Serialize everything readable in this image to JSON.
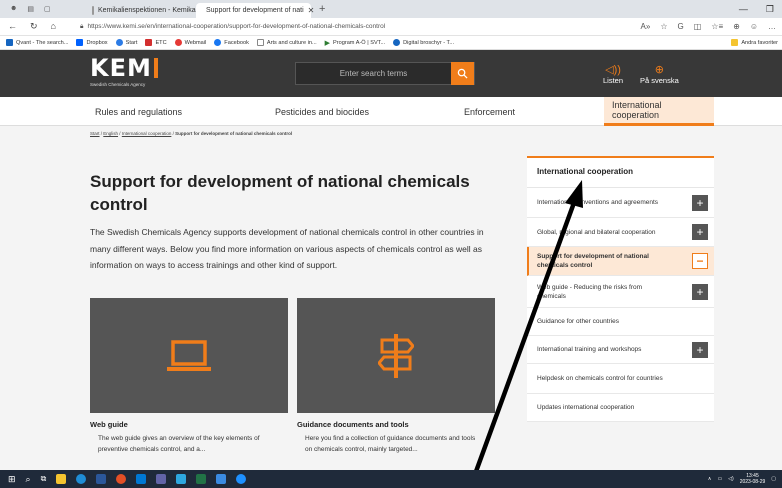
{
  "browser": {
    "tabs": [
      {
        "title": "Kemikalienspektionen - Kemikal"
      },
      {
        "title": "Support for development of nati"
      }
    ],
    "new_tab": "+",
    "url": "https://www.kemi.se/en/international-cooperation/support-for-development-of-national-chemicals-control",
    "bookmarks": [
      "Qvant - The search...",
      "Dropbox",
      "Start",
      "ETC",
      "Webmail",
      "Facebook",
      "Arts and culture in...",
      "Program A-Ö | SVT...",
      "Digital broschyr - T..."
    ],
    "bookmarks_other": "Andra favoriter"
  },
  "header": {
    "logo_text": "KEM",
    "logo_sub": "Swedish Chemicals Agency",
    "search_placeholder": "Enter search terms",
    "listen_label": "Listen",
    "swedish_label": "På svenska"
  },
  "nav": {
    "items": [
      "Rules and regulations",
      "Pesticides and biocides",
      "Enforcement",
      "International cooperation"
    ]
  },
  "breadcrumb": {
    "start": "Start",
    "english": "English",
    "intl": "International cooperation",
    "current": "Support for development of national chemicals control",
    "sep": " / "
  },
  "main": {
    "title": "Support for development of national chemicals control",
    "intro": "The Swedish Chemicals Agency supports development of national chemicals control in other countries in many different ways. Below you find more information on various aspects of chemicals control as well as information on ways to access trainings and other kind of support.",
    "cards": [
      {
        "title": "Web guide",
        "desc": "The web guide gives an overview of the key elements of preventive chemicals control, and a...",
        "icon": "laptop-icon"
      },
      {
        "title": "Guidance documents and tools",
        "desc": "Here you find a collection of guidance documents and tools on chemicals control, mainly targeted...",
        "icon": "signpost-icon"
      }
    ]
  },
  "sidebar": {
    "heading": "International cooperation",
    "items": [
      {
        "label": "International conventions and agreements",
        "toggle": "+"
      },
      {
        "label": "Global, regional and bilateral cooperation",
        "toggle": "+"
      },
      {
        "label": "Support for development of national chemicals control",
        "toggle": "−"
      },
      {
        "label": "Web guide - Reducing the risks from chemicals",
        "toggle": "+"
      },
      {
        "label": "Guidance for other countries",
        "toggle": ""
      },
      {
        "label": "International training and workshops",
        "toggle": "+"
      },
      {
        "label": "Helpdesk on chemicals control for countries",
        "toggle": ""
      },
      {
        "label": "Updates international cooperation",
        "toggle": ""
      }
    ]
  },
  "taskbar": {
    "time": "13:45",
    "date": "2023-08-29"
  },
  "colors": {
    "accent": "#f07d1a",
    "header_bg": "#383838",
    "card_bg": "#555555"
  }
}
